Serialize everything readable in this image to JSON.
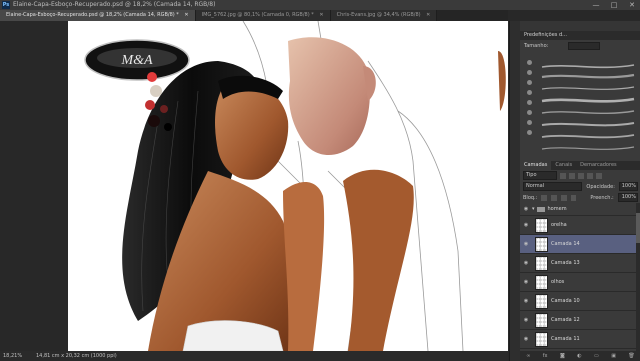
{
  "app": {
    "title": "Elaine-Capa-Esboço-Recuperado.psd @ 18,2% (Camada 14, RGB/8)",
    "logo": "Ps",
    "window_controls": [
      "—",
      "□",
      "✕"
    ]
  },
  "tabs": [
    {
      "label": "Elaine-Capa-Esboço-Recuperado.psd @ 18,2% (Camada 14, RGB/8) *",
      "active": true
    },
    {
      "label": "IMG_5762.jpg @ 80,1% (Camada 0, RGB/8) *",
      "active": false
    },
    {
      "label": "Chris-Evans.jpg @ 34,4% (RGB/8)",
      "active": false
    }
  ],
  "tab_close": "✕",
  "canvas": {
    "logo_text": "M&A"
  },
  "status": {
    "zoom": "18,21%",
    "doc_info": "14,81 cm x 20,32 cm (1000 ppi)"
  },
  "brush_panel": {
    "tabs": [
      "Predefinições d..."
    ],
    "size_label": "Tamanho:"
  },
  "layers_panel": {
    "tabs": [
      "Camadas",
      "Canais",
      "Demarcadores"
    ],
    "filter_label": "Tipo",
    "blend_mode": "Normal",
    "opacity_label": "Opacidade:",
    "opacity_value": "100%",
    "lock_label": "Bloq.:",
    "fill_label": "Preench.:",
    "fill_value": "100%",
    "group": {
      "name": "homem"
    },
    "layers": [
      {
        "name": "orelha",
        "selected": false
      },
      {
        "name": "Camada 14",
        "selected": true
      },
      {
        "name": "Camada 13",
        "selected": false
      },
      {
        "name": "olhos",
        "selected": false
      },
      {
        "name": "Camada 10",
        "selected": false
      },
      {
        "name": "Camada 12",
        "selected": false
      },
      {
        "name": "Camada 11",
        "selected": false
      }
    ],
    "footer_icons": [
      "link-icon",
      "fx-icon",
      "mask-icon",
      "adjustment-icon",
      "folder-icon",
      "new-layer-icon",
      "trash-icon"
    ],
    "footer_glyphs": [
      "∞",
      "fx",
      "◙",
      "◐",
      "▭",
      "▣",
      "🗑"
    ]
  },
  "colors": {
    "accent_selected": "#596080",
    "skin_dark": "#a0582e",
    "skin_light": "#d8a888",
    "hair": "#111111",
    "swatch_red": "#e23b3b"
  }
}
